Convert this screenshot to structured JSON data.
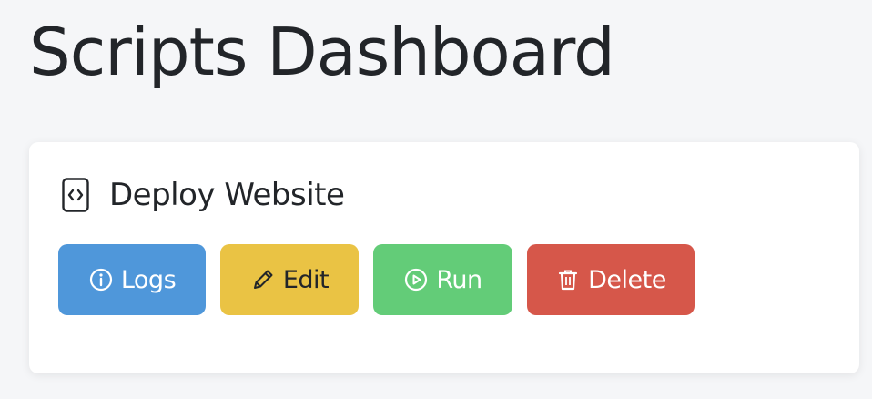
{
  "page": {
    "title": "Scripts Dashboard"
  },
  "script": {
    "name": "Deploy Website",
    "icon": "file-code-icon"
  },
  "actions": {
    "logs": {
      "label": "Logs",
      "icon": "info-icon",
      "color": "#4f97da"
    },
    "edit": {
      "label": "Edit",
      "icon": "pencil-icon",
      "color": "#eac344"
    },
    "run": {
      "label": "Run",
      "icon": "play-circle-icon",
      "color": "#63cc78"
    },
    "delete": {
      "label": "Delete",
      "icon": "trash-icon",
      "color": "#d6574a"
    }
  }
}
